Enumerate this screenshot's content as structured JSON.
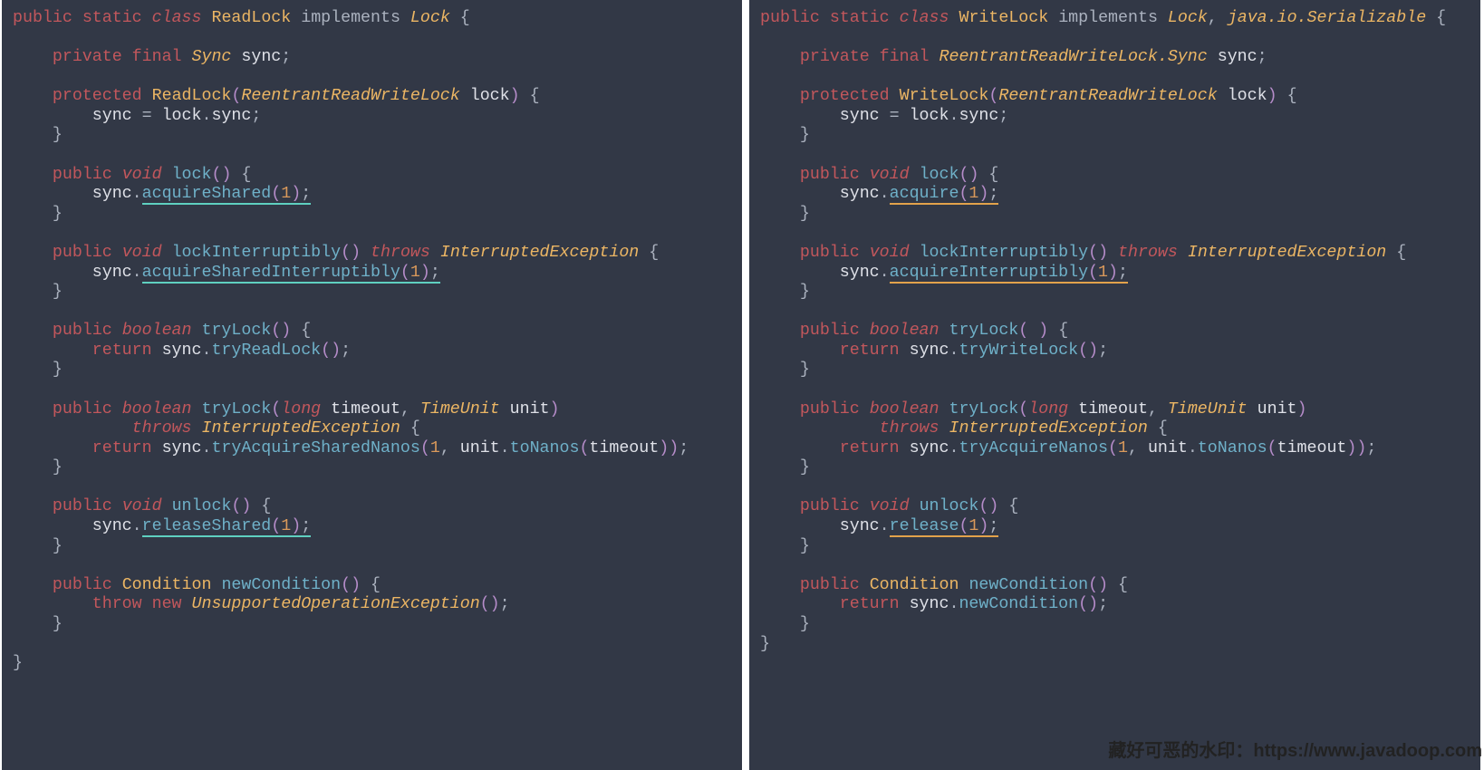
{
  "footer": {
    "text": "藏好可恶的水印：https://www.javadoop.com"
  },
  "tokens": {
    "kw": {
      "public": "public",
      "static": "static",
      "private": "private",
      "final": "final",
      "protected": "protected",
      "return": "return",
      "throw": "throw",
      "new": "new"
    },
    "kwit": {
      "class": "class",
      "void": "void",
      "boolean": "boolean",
      "long": "long",
      "throws": "throws"
    },
    "types": {
      "ReadLock": "ReadLock",
      "WriteLock": "WriteLock",
      "Condition": "Condition",
      "TimeUnit": "TimeUnit"
    },
    "typesItalic": {
      "Lock": "Lock",
      "Sync": "Sync",
      "ReentrantReadWriteLock": "ReentrantReadWriteLock",
      "InterruptedException": "InterruptedException",
      "UnsupportedOperationException": "UnsupportedOperationException",
      "java_io_Serializable": "java.io.Serializable",
      "RRWL_Sync": "ReentrantReadWriteLock.Sync"
    },
    "implements": "implements",
    "methods": {
      "lock": "lock",
      "lockInterruptibly": "lockInterruptibly",
      "tryLock": "tryLock",
      "unlock": "unlock",
      "newCondition": "newCondition",
      "tryReadLock": "tryReadLock",
      "tryWriteLock": "tryWriteLock",
      "tryAcquireSharedNanos": "tryAcquireSharedNanos",
      "tryAcquireNanos": "tryAcquireNanos",
      "toNanos": "toNanos",
      "acquireShared": "acquireShared",
      "acquire": "acquire",
      "acquireSharedInterruptibly": "acquireSharedInterruptibly",
      "acquireInterruptibly": "acquireInterruptibly",
      "releaseShared": "releaseShared",
      "release": "release"
    },
    "ids": {
      "sync": "sync",
      "lock": "lock",
      "timeout": "timeout",
      "unit": "unit"
    },
    "punct": {
      "eq": " = ",
      "dot": ".",
      "semi": ";",
      "sp": " ",
      "com": ", ",
      "ob": "{",
      "cb": "}"
    },
    "paren": {
      "op": "(",
      "cp": ")"
    },
    "num": {
      "one": "1"
    }
  }
}
